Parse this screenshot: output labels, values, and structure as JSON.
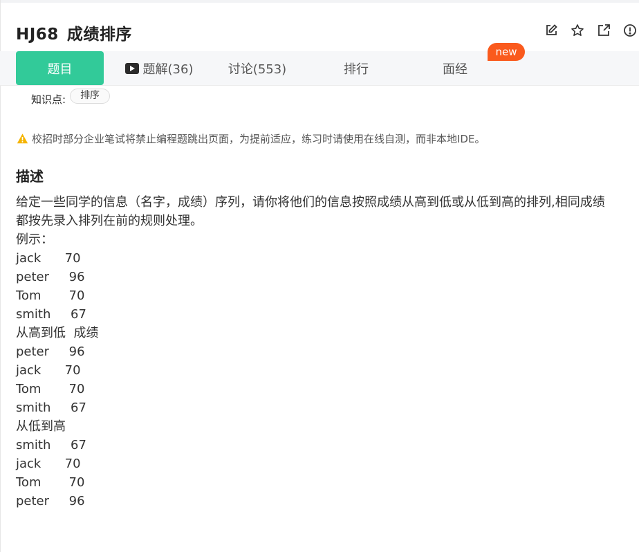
{
  "problem": {
    "id": "HJ68",
    "title": "成绩排序"
  },
  "icons": [
    "edit-icon",
    "star-icon",
    "external-link-icon",
    "info-icon"
  ],
  "tabs": [
    {
      "label": "题目"
    },
    {
      "label": "题解(36)"
    },
    {
      "label": "讨论(553)"
    },
    {
      "label": "排行"
    },
    {
      "label": "面经"
    }
  ],
  "new_badge": "new",
  "knowledge": {
    "label": "知识点:",
    "tag": "排序"
  },
  "warning": "校招时部分企业笔试将禁止编程题跳出页面，为提前适应，练习时请使用在线自测，而非本地IDE。",
  "description": {
    "heading": "描述",
    "lines": [
      "给定一些同学的信息（名字，成绩）序列，请你将他们的信息按照成绩从高到低或从低到高的排列,相同成绩",
      "都按先录入排列在前的规则处理。",
      "例示：",
      "jack      70",
      "peter     96",
      "Tom       70",
      "smith     67",
      "从高到低  成绩",
      "peter     96",
      "jack      70",
      "Tom       70",
      "smith     67",
      "从低到高",
      "smith     67",
      "jack      70",
      "Tom       70",
      "peter     96"
    ]
  },
  "colors": {
    "accent": "#32ca99",
    "badge": "#fa5a1d",
    "warning": "#f5b400"
  }
}
